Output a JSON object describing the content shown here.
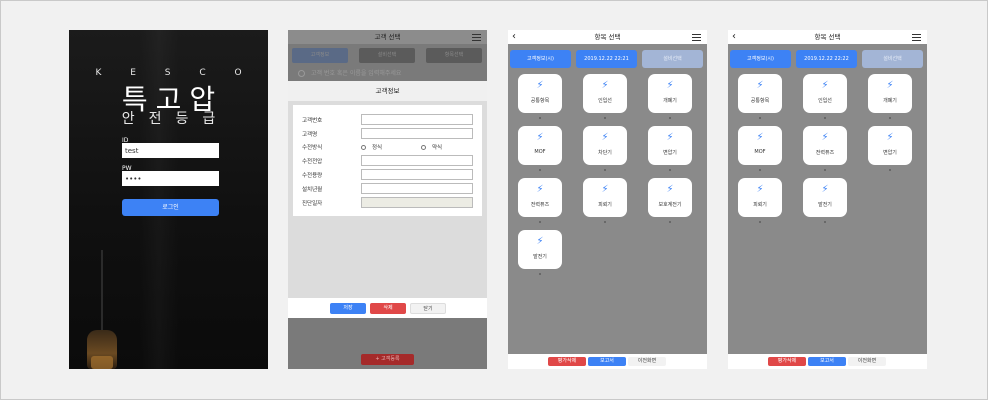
{
  "login": {
    "brand_letters": "K E S C O",
    "title": "특고압",
    "subtitle": "안전등급",
    "id_label": "ID",
    "id_value": "test",
    "pw_label": "PW",
    "pw_value": "••••",
    "login_button": "로그인"
  },
  "customer": {
    "header_title": "고객 선택",
    "tabs": [
      "고객정보",
      "설비선택",
      "항목선택"
    ],
    "hint": "고객 번호 혹은 이름을 입력해주세요",
    "modal_title": "고객정보",
    "fields": [
      "고객번호",
      "고객명",
      "수전방식",
      "수전전압",
      "수전용량",
      "설치년월",
      "진단일자"
    ],
    "radio_options": [
      "정식",
      "약식"
    ],
    "buttons": {
      "save": "저장",
      "delete": "삭제",
      "close": "닫기"
    },
    "register_button": "+ 고객등록",
    "colors": {
      "save": "#3d82f5",
      "delete": "#e04848",
      "close": "#f2f2f2"
    }
  },
  "items_a": {
    "header_title": "항목 선택",
    "tabs": [
      "고객정보(시)",
      "2019.12.22 22:21",
      "설비선택"
    ],
    "tiles": [
      "공통항목",
      "인입선",
      "개폐기",
      "MOF",
      "차단기",
      "변압기",
      "전력퓨즈",
      "피뢰기",
      "보호계전기",
      "발전기"
    ],
    "footer": [
      "평가삭제",
      "보고서",
      "이전화면"
    ]
  },
  "items_b": {
    "header_title": "항목 선택",
    "tabs": [
      "고객정보(시)",
      "2019.12.22 22:22",
      "설비선택"
    ],
    "tiles": [
      "공통항목",
      "인입선",
      "개폐기",
      "MOF",
      "전력퓨즈",
      "변압기",
      "피뢰기",
      "발전기"
    ],
    "footer": [
      "평가삭제",
      "보고서",
      "이전화면"
    ]
  },
  "icons": {
    "bolt": "lightning-icon",
    "menu": "hamburger-menu-icon",
    "back": "back-arrow-icon"
  },
  "accent": "#3d82f5"
}
